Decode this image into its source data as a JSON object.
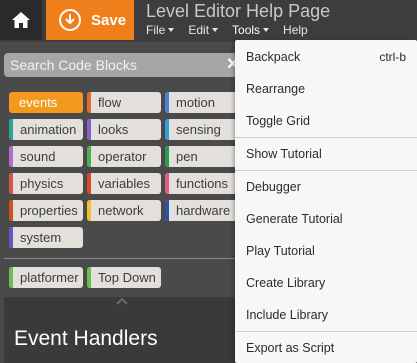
{
  "header": {
    "home_icon": "home-icon",
    "save_icon": "download-circle-icon",
    "save_label": "Save",
    "save_color": "#ef7f1a",
    "title": "Level Editor Help Page",
    "menus": [
      "File",
      "Edit",
      "Tools",
      "Help"
    ]
  },
  "search": {
    "placeholder": "Search Code Blocks",
    "value": "",
    "clear_icon": "close-icon"
  },
  "categories": [
    {
      "label": "events",
      "color": "#f39a1e",
      "selected": true
    },
    {
      "label": "flow",
      "color": "#e26b2e",
      "selected": false
    },
    {
      "label": "motion",
      "color": "#4d7fd6",
      "selected": false
    },
    {
      "label": "animation",
      "color": "#27a49a",
      "selected": false
    },
    {
      "label": "looks",
      "color": "#8b5cd6",
      "selected": false
    },
    {
      "label": "sensing",
      "color": "#2f9fe0",
      "selected": false
    },
    {
      "label": "sound",
      "color": "#b36ad8",
      "selected": false
    },
    {
      "label": "operator",
      "color": "#4caf50",
      "selected": false
    },
    {
      "label": "pen",
      "color": "#2a9d4a",
      "selected": false
    },
    {
      "label": "physics",
      "color": "#e0504e",
      "selected": false
    },
    {
      "label": "variables",
      "color": "#d9472b",
      "selected": false
    },
    {
      "label": "functions",
      "color": "#e05a89",
      "selected": false
    },
    {
      "label": "properties",
      "color": "#d1521f",
      "selected": false
    },
    {
      "label": "network",
      "color": "#f2c12e",
      "selected": false
    },
    {
      "label": "hardware",
      "color": "#2e4fb0",
      "selected": false
    },
    {
      "label": "system",
      "color": "#5b59c7",
      "selected": false
    }
  ],
  "libraries": [
    {
      "label": "platformer",
      "color": "#6dbf4b"
    },
    {
      "label": "Top Down",
      "color": "#6dbf4b"
    }
  ],
  "panel": {
    "title": "Event Handlers",
    "collapse_icon": "chevron-up-icon"
  },
  "tools_menu": {
    "items": [
      {
        "label": "Backpack",
        "shortcut": "ctrl-b"
      },
      {
        "label": "Rearrange",
        "shortcut": ""
      },
      {
        "label": "Toggle Grid",
        "shortcut": ""
      },
      {
        "label": "Show Tutorial",
        "shortcut": ""
      },
      {
        "label": "Debugger",
        "shortcut": ""
      },
      {
        "label": "Generate Tutorial",
        "shortcut": ""
      },
      {
        "label": "Play Tutorial",
        "shortcut": ""
      },
      {
        "label": "Create Library",
        "shortcut": ""
      },
      {
        "label": "Include Library",
        "shortcut": ""
      },
      {
        "label": "Export as Script",
        "shortcut": ""
      }
    ]
  }
}
